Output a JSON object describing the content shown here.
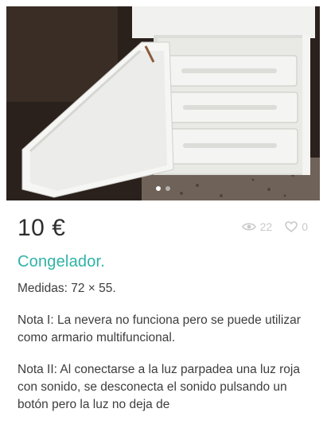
{
  "listing": {
    "price": "10 €",
    "views": "22",
    "likes": "0",
    "title": "Congelador.",
    "description": [
      "Medidas: 72 × 55.",
      "Nota I: La nevera no funciona pero se puede utilizar como armario multifuncional.",
      "Nota II: Al conectarse a la luz parpadea una luz roja con sonido, se desconecta el sonido pulsando un botón pero la luz no deja de"
    ]
  },
  "gallery": {
    "image_count": 2,
    "active_index": 0
  },
  "colors": {
    "accent": "#2fb3a6",
    "price": "#2e2e2e",
    "muted": "#c9c9c9"
  },
  "icons": {
    "views": "eye-icon",
    "likes": "heart-icon"
  }
}
